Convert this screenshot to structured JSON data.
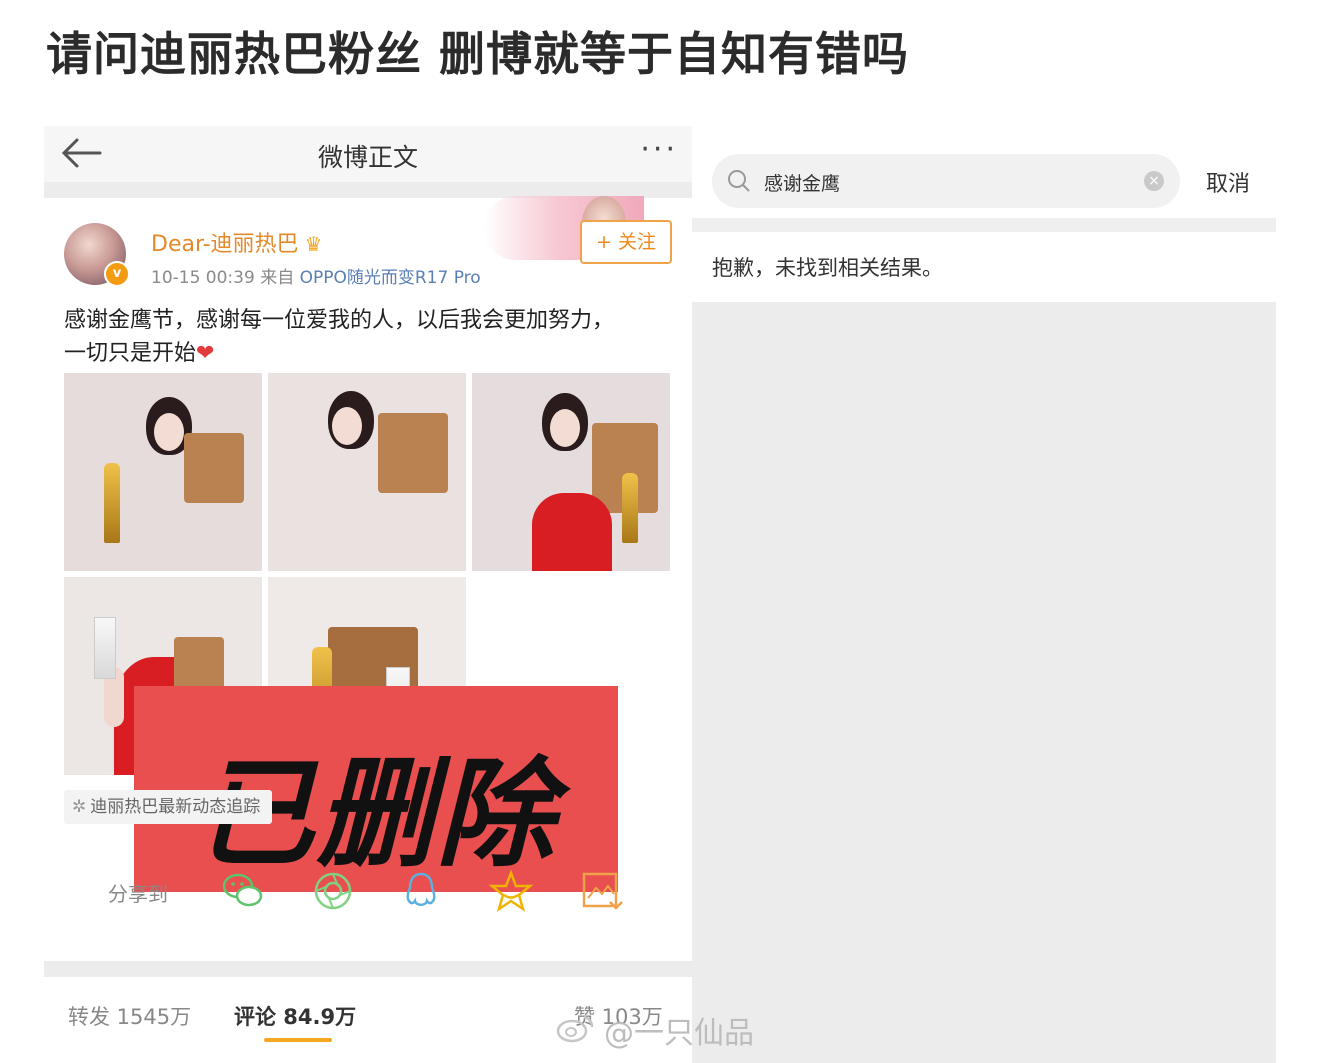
{
  "headline": "请问迪丽热巴粉丝 删博就等于自知有错吗",
  "weibo_detail": {
    "nav": {
      "title": "微博正文",
      "more": "···"
    },
    "post": {
      "username": "Dear-迪丽热巴",
      "meta_time": "10-15 00:39",
      "meta_source_prefix": "来自",
      "meta_device": "OPPO随光而变R17 Pro",
      "follow_label": "+ 关注",
      "text": "感谢金鹰节，感谢每一位爱我的人，以后我会更加努力，一切只是开始",
      "deleted_overlay": "已删除",
      "tag": "迪丽热巴最新动态追踪",
      "verified_badge": "v"
    },
    "share": {
      "label": "分享到",
      "icons": [
        "wechat-icon",
        "moments-icon",
        "qq-icon",
        "favorite-star-icon",
        "image-save-icon"
      ]
    },
    "stats": {
      "repost": "转发 1545万",
      "comment": "评论 84.9万",
      "like": "赞 103万"
    }
  },
  "search": {
    "query": "感谢金鹰",
    "cancel_label": "取消",
    "empty_message": "抱歉，未找到相关结果。"
  },
  "watermark": "@一只仙品",
  "colors": {
    "accent": "#f5a623",
    "username": "#e58a2b",
    "deleted_bg": "#e94f4f",
    "follow": "#f08a1c"
  }
}
